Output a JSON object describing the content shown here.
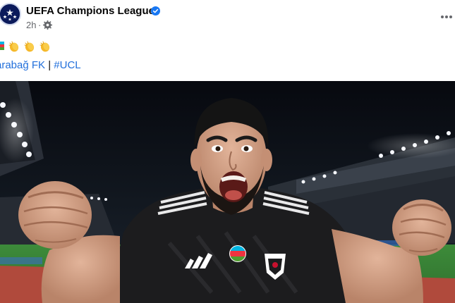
{
  "post": {
    "author": "UEFA Champions League",
    "time": "2h",
    "separator": "·",
    "verified_icon": "verified-badge-icon",
    "audience_icon": "gear-icon",
    "more_icon": "more-options-icon"
  },
  "caption": {
    "emojis": [
      "🇦🇿",
      "👏",
      "👏",
      "👏"
    ],
    "tags": [
      {
        "text": "Qarabağ FK",
        "visible_text": "arabağ FK"
      },
      {
        "text": "#UCL",
        "visible_text": "#UCL"
      }
    ],
    "tag_separator": "|"
  },
  "photo": {
    "subject": "celebrating footballer",
    "shirt_color": "#1a1a1a",
    "pitch_color": "#3f8a3a",
    "sky_color": "#0a0d14"
  },
  "colors": {
    "link": "#216fdb",
    "secondary_text": "#65676b",
    "verified": "#1877f2"
  }
}
